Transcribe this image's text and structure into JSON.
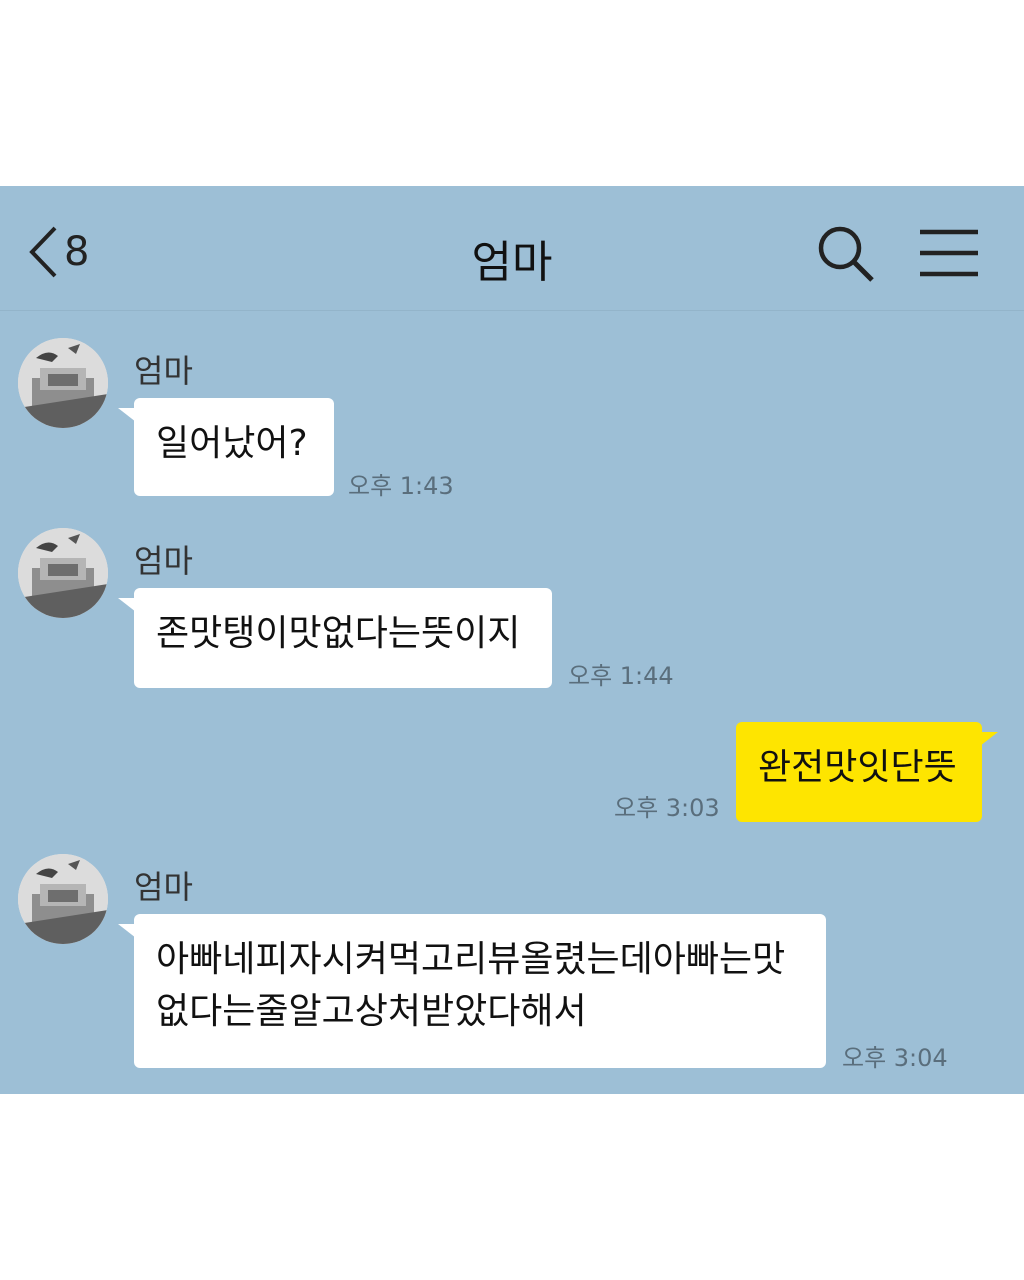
{
  "header": {
    "back_count": "8",
    "title": "엄마"
  },
  "messages": [
    {
      "sender": "엄마",
      "text": "일어났어?",
      "time": "오후 1:43",
      "direction": "incoming"
    },
    {
      "sender": "엄마",
      "text": "존맛탱이맛없다는뜻이지",
      "time": "오후 1:44",
      "direction": "incoming"
    },
    {
      "sender": "",
      "text": "완전맛잇단뜻",
      "time": "오후 3:03",
      "direction": "outgoing"
    },
    {
      "sender": "엄마",
      "text": "아빠네피자시켜먹고리뷰올렸는데아빠는맛없다는줄알고상처받았다해서",
      "time": "오후 3:04",
      "direction": "incoming"
    }
  ],
  "colors": {
    "background": "#9dbfd6",
    "outgoing_bubble": "#fee500",
    "incoming_bubble": "#ffffff"
  },
  "icons": [
    "back-chevron-icon",
    "search-icon",
    "menu-icon"
  ]
}
